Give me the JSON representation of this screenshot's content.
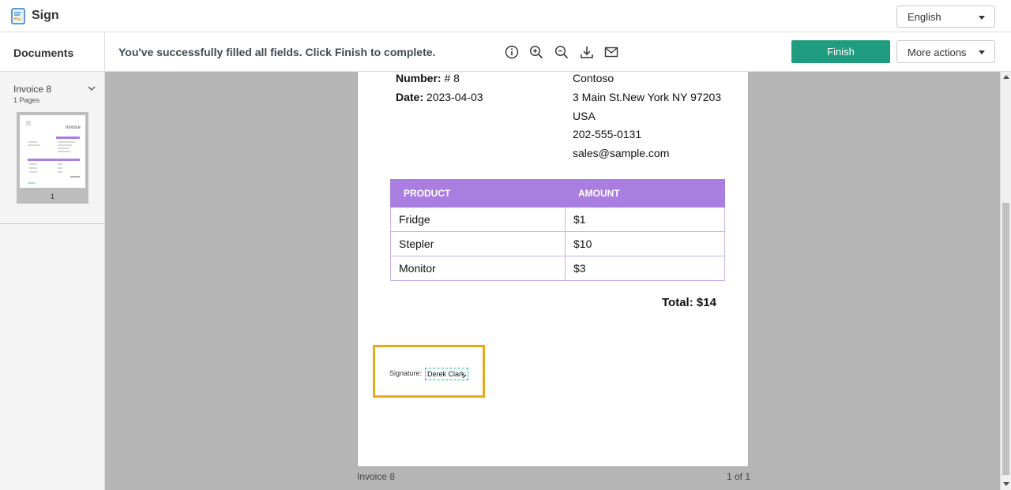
{
  "app": {
    "title": "Sign",
    "logo_icon": "sign-document-icon"
  },
  "language_select": {
    "value": "English"
  },
  "toolbar": {
    "documents_label": "Documents",
    "status_message": "You've successfully filled all fields. Click Finish to complete.",
    "icons": [
      "info-icon",
      "zoom-in-icon",
      "zoom-out-icon",
      "download-icon",
      "email-icon"
    ],
    "finish_label": "Finish",
    "more_actions_label": "More actions",
    "accent_color": "#1f9c7f"
  },
  "documents": {
    "items": [
      {
        "name": "Invoice 8",
        "pages": "1 Pages",
        "thumbnail_page": "1"
      }
    ]
  },
  "invoice": {
    "number_label": "Number:",
    "number_value": "# 8",
    "date_label": "Date:",
    "date_value": "2023-04-03",
    "company": "Contoso",
    "address": "3 Main St.New York NY 97203",
    "country": "USA",
    "phone": "202-555-0131",
    "email": "sales@sample.com",
    "table": {
      "headers": [
        "PRODUCT",
        "AMOUNT"
      ],
      "rows": [
        {
          "product": "Fridge",
          "amount": "$1"
        },
        {
          "product": "Stepler",
          "amount": "$10"
        },
        {
          "product": "Monitor",
          "amount": "$3"
        }
      ]
    },
    "total": "Total: $14",
    "signature_label": "Signature:",
    "signature_value": "Derek Clark",
    "header_color": "#a97ee0",
    "highlight_color": "#e8a919"
  },
  "page_footer": {
    "name": "Invoice 8",
    "page_count": "1 of 1"
  }
}
